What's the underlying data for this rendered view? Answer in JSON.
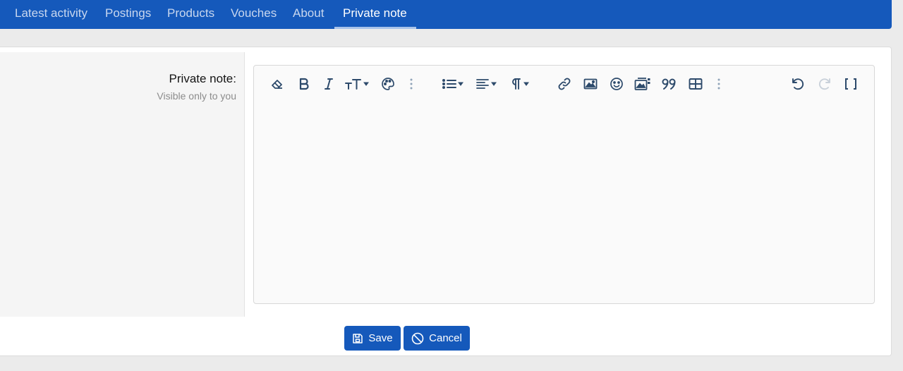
{
  "tabs": [
    {
      "label": "Latest activity",
      "active": false
    },
    {
      "label": "Postings",
      "active": false
    },
    {
      "label": "Products",
      "active": false
    },
    {
      "label": "Vouches",
      "active": false
    },
    {
      "label": "About",
      "active": false
    },
    {
      "label": "Private note",
      "active": true
    }
  ],
  "form": {
    "label": "Private note:",
    "hint": "Visible only to you",
    "editor_content": ""
  },
  "toolbar": {
    "groups": [
      [
        "eraser-icon",
        "bold-icon",
        "italic-icon",
        "text-size-icon",
        "palette-icon",
        "more-vertical-icon"
      ],
      [
        "list-icon",
        "align-icon",
        "paragraph-icon"
      ],
      [
        "link-icon",
        "image-icon",
        "smiley-icon",
        "media-icon",
        "quote-icon",
        "table-icon",
        "more-vertical-icon"
      ],
      [
        "undo-icon",
        "redo-icon",
        "brackets-icon"
      ]
    ]
  },
  "actions": {
    "save_label": "Save",
    "cancel_label": "Cancel",
    "save_icon": "floppy-disk-icon",
    "cancel_icon": "ban-icon"
  },
  "colors": {
    "brand": "#1559bb",
    "tab_inactive_text": "#c8d7ef",
    "tab_active_text": "#ffffff"
  }
}
